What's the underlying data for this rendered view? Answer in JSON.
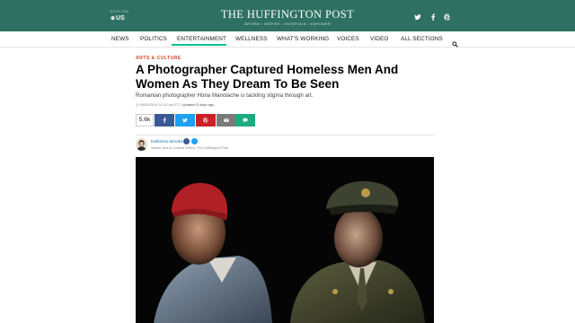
{
  "header": {
    "edition_label": "EDITION",
    "edition_value": "US",
    "logo_title": "THE HUFFINGTON POST",
    "logo_tagline": "INFORM • INSPIRE • ENTERTAIN • EMPOWER",
    "social_icons": [
      "twitter-icon",
      "facebook-icon",
      "pinterest-icon"
    ],
    "brand_color": "#2e7061"
  },
  "nav": {
    "items": [
      "NEWS",
      "POLITICS",
      "ENTERTAINMENT",
      "WELLNESS",
      "WHAT'S WORKING",
      "VOICES",
      "VIDEO",
      "ALL SECTIONS"
    ],
    "active": "ENTERTAINMENT",
    "accent_color": "#0dbe98"
  },
  "article": {
    "section": "ARTS & CULTURE",
    "headline": "A Photographer Captured Homeless Men And Women As They Dream To Be Seen",
    "dek": "Romanian photographer Horia Manolache is tackling stigma through art.",
    "timestamp": "06/06/2016 11:02 am ET",
    "updated_label": "Updated 5 days ago",
    "share_count": "5.6k",
    "share_buttons": [
      "facebook-icon",
      "twitter-icon",
      "pinterest-icon",
      "email-icon",
      "comment-icon"
    ],
    "section_color": "#d24b2a"
  },
  "author": {
    "name": "Katherine Brooks",
    "title": "Senior Arts & Culture Editor, The Huffington Post"
  }
}
